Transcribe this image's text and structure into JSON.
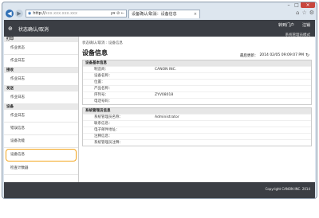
{
  "browser": {
    "url_prefix": "http://",
    "url_host": "xxx.xxx.xxx.xxx",
    "url_tools": "ρ▾ ⊘ ←",
    "tab_label": "设备确认/取消：设备信息",
    "tab_close": "×",
    "window_buttons": {
      "minimize": "–",
      "maximize": "□",
      "close": "×"
    },
    "icons": [
      "home-icon",
      "star-icon",
      "gear-icon"
    ]
  },
  "header": {
    "app_title": "状态确认/取消",
    "links": [
      "转到门户",
      "注销"
    ],
    "mode": "系统管理员模式"
  },
  "sidebar": [
    {
      "group": "打印",
      "items": [
        "作业状态",
        "作业日志"
      ]
    },
    {
      "group": "接收",
      "items": [
        "作业日志"
      ]
    },
    {
      "group": "发送",
      "items": [
        "作业日志"
      ]
    },
    {
      "group": "设备",
      "items": [
        "作业日志",
        "错误信息",
        "设备功能",
        "设备信息",
        "检查计数器"
      ]
    }
  ],
  "main": {
    "breadcrumb": "状态确认/取消 : 设备信息",
    "title": "设备信息",
    "last_updated_label": "最后更新：",
    "last_updated_value": "2014 02/05 09:09:07 PM",
    "sections": [
      {
        "title": "设备基本信息",
        "rows": [
          {
            "key": "制造商：",
            "value": "CANON INC."
          },
          {
            "key": "设备名称：",
            "value": ""
          },
          {
            "key": "位置：",
            "value": ""
          },
          {
            "key": "产品名称：",
            "value": ""
          },
          {
            "key": "序列号：",
            "value": "ZYV08018"
          },
          {
            "key": "电话号码：",
            "value": ""
          }
        ]
      },
      {
        "title": "系统管理员信息",
        "rows": [
          {
            "key": "系统管理员名称：",
            "value": "Administrator"
          },
          {
            "key": "联系信息：",
            "value": ""
          },
          {
            "key": "电子邮件地址：",
            "value": ""
          },
          {
            "key": "注释信息：",
            "value": ""
          },
          {
            "key": "系统管理员注释：",
            "value": ""
          }
        ]
      }
    ]
  },
  "footer": {
    "copyright": "Copyright CANON INC. 2014"
  }
}
